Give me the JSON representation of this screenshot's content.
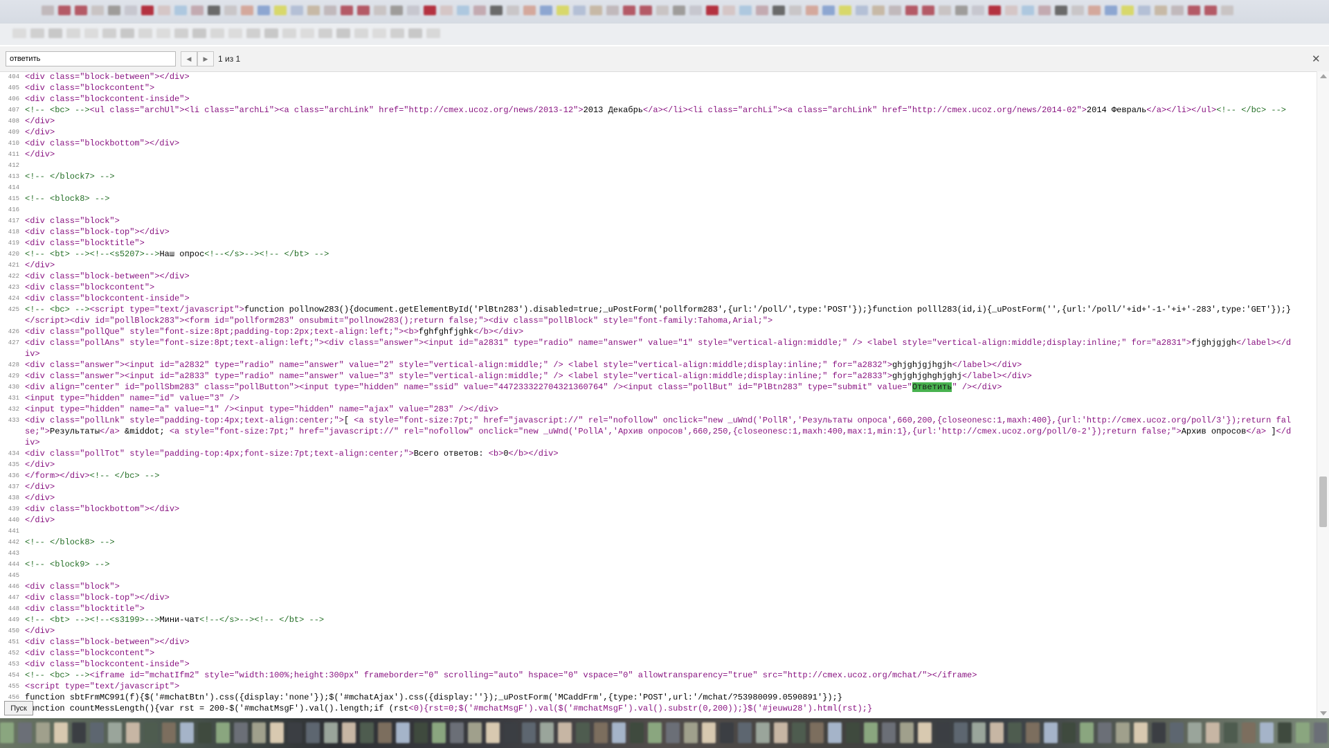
{
  "find_bar": {
    "query": "ответить",
    "prev_icon": "triangle-left-icon",
    "next_icon": "triangle-right-icon",
    "match_count": "1 из 1",
    "close_icon": "close-icon",
    "close_symbol": "✕"
  },
  "taskbar": {
    "start_label": "Пуск"
  },
  "scrollbar": {
    "position_fraction": 0.58
  },
  "source_lines": [
    {
      "n": "404",
      "html": "&lt;div class=\"block-between\"&gt;&lt;/div&gt;"
    },
    {
      "n": "405",
      "html": "&lt;div class=\"blockcontent\"&gt;"
    },
    {
      "n": "406",
      "html": "&lt;div class=\"blockcontent-inside\"&gt;"
    },
    {
      "n": "407",
      "html": "&lt;!-- &lt;bc&gt; --&gt;&lt;ul class=\"archUl\"&gt;&lt;li class=\"archLi\"&gt;&lt;a class=\"archLink\" href=\"http://cmex.ucoz.org/news/2013-12\"&gt;2013 Декабрь&lt;/a&gt;&lt;/li&gt;&lt;li class=\"archLi\"&gt;&lt;a class=\"archLink\" href=\"http://cmex.ucoz.org/news/2014-02\"&gt;2014 Февраль&lt;/a&gt;&lt;/li&gt;&lt;/ul&gt;&lt;!-- &lt;/bc&gt; --&gt;"
    },
    {
      "n": "408",
      "html": "&lt;/div&gt;"
    },
    {
      "n": "409",
      "html": "&lt;/div&gt;"
    },
    {
      "n": "410",
      "html": "&lt;div class=\"blockbottom\"&gt;&lt;/div&gt;"
    },
    {
      "n": "411",
      "html": "&lt;/div&gt;"
    },
    {
      "n": "412",
      "html": ""
    },
    {
      "n": "413",
      "html": "&lt;!-- &lt;/block7&gt; --&gt;"
    },
    {
      "n": "414",
      "html": ""
    },
    {
      "n": "415",
      "html": "&lt;!-- &lt;block8&gt; --&gt;"
    },
    {
      "n": "416",
      "html": ""
    },
    {
      "n": "417",
      "html": "&lt;div class=\"block\"&gt;"
    },
    {
      "n": "418",
      "html": "&lt;div class=\"block-top\"&gt;&lt;/div&gt;"
    },
    {
      "n": "419",
      "html": "&lt;div class=\"blocktitle\"&gt;"
    },
    {
      "n": "420",
      "html": "&lt;!-- &lt;bt&gt; --&gt;&lt;!--&lt;s5207&gt;--&gt;Наш опрос&lt;!--&lt;/s&gt;--&gt;&lt;!-- &lt;/bt&gt; --&gt;"
    },
    {
      "n": "421",
      "html": "&lt;/div&gt;"
    },
    {
      "n": "422",
      "html": "&lt;div class=\"block-between\"&gt;&lt;/div&gt;"
    },
    {
      "n": "423",
      "html": "&lt;div class=\"blockcontent\"&gt;"
    },
    {
      "n": "424",
      "html": "&lt;div class=\"blockcontent-inside\"&gt;"
    },
    {
      "n": "425",
      "html": "&lt;!-- &lt;bc&gt; --&gt;&lt;script type=\"text/javascript\"&gt;function pollnow283(){document.getElementById('PlBtn283').disabled=true;_uPostForm('pollform283',{url:'/poll/',type:'POST'});}function polll283(id,i){_uPostForm('',{url:'/poll/'+id+'-1-'+i+'-283',type:'GET'});}&lt;/script&gt;&lt;div id=\"pollBlock283\"&gt;&lt;form id=\"pollform283\" onsubmit=\"pollnow283();return false;\"&gt;&lt;div class=\"pollBlock\" style=\"font-family:Tahoma,Arial;\"&gt;"
    },
    {
      "n": "426",
      "html": "&lt;div class=\"pollQue\" style=\"font-size:8pt;padding-top:2px;text-align:left;\"&gt;&lt;b&gt;fghfghfjghk&lt;/b&gt;&lt;/div&gt;"
    },
    {
      "n": "427",
      "html": "&lt;div class=\"pollAns\" style=\"font-size:8pt;text-align:left;\"&gt;&lt;div class=\"answer\"&gt;&lt;input id=\"a2831\" type=\"radio\" name=\"answer\" value=\"1\" style=\"vertical-align:middle;\" /&gt; &lt;label style=\"vertical-align:middle;display:inline;\" for=\"a2831\"&gt;fjghjgjgh&lt;/label&gt;&lt;/div&gt;"
    },
    {
      "n": "428",
      "html": "&lt;div class=\"answer\"&gt;&lt;input id=\"a2832\" type=\"radio\" name=\"answer\" value=\"2\" style=\"vertical-align:middle;\" /&gt; &lt;label style=\"vertical-align:middle;display:inline;\" for=\"a2832\"&gt;ghjghjgjhgjh&lt;/label&gt;&lt;/div&gt;"
    },
    {
      "n": "429",
      "html": "&lt;div class=\"answer\"&gt;&lt;input id=\"a2833\" type=\"radio\" name=\"answer\" value=\"3\" style=\"vertical-align:middle;\" /&gt; &lt;label style=\"vertical-align:middle;display:inline;\" for=\"a2833\"&gt;ghjghjghghjghj&lt;/label&gt;&lt;/div&gt;"
    },
    {
      "n": "430",
      "html": "&lt;div align=\"center\" id=\"pollSbm283\" class=\"pollButton\"&gt;&lt;input type=\"hidden\" name=\"ssid\" value=\"447233322704321360764\" /&gt;&lt;input class=\"pollBut\" id=\"PlBtn283\" type=\"submit\" value=\"Ответить\" /&gt;&lt;/div&gt;"
    },
    {
      "n": "431",
      "html": "&lt;input type=\"hidden\" name=\"id\" value=\"3\" /&gt;"
    },
    {
      "n": "432",
      "html": "&lt;input type=\"hidden\" name=\"a\" value=\"1\" /&gt;&lt;input type=\"hidden\" name=\"ajax\" value=\"283\" /&gt;&lt;/div&gt;"
    },
    {
      "n": "433",
      "html": "&lt;div class=\"pollLnk\" style=\"padding-top:4px;text-align:center;\"&gt;[ &lt;a style=\"font-size:7pt;\" href=\"javascript://\" rel=\"nofollow\" onclick=\"new _uWnd('PollR','Результаты опроса',660,200,{closeonesc:1,maxh:400},{url:'http://cmex.ucoz.org/poll/3'});return false;\"&gt;Результаты&lt;/a&gt; &amp;middot; &lt;a style=\"font-size:7pt;\" href=\"javascript://\" rel=\"nofollow\" onclick=\"new _uWnd('PollA','Архив опросов',660,250,{closeonesc:1,maxh:400,max:1,min:1},{url:'http://cmex.ucoz.org/poll/0-2'});return false;\"&gt;Архив опросов&lt;/a&gt; ]&lt;/div&gt;"
    },
    {
      "n": "434",
      "html": "&lt;div class=\"pollTot\" style=\"padding-top:4px;font-size:7pt;text-align:center;\"&gt;Всего ответов: &lt;b&gt;0&lt;/b&gt;&lt;/div&gt;"
    },
    {
      "n": "435",
      "html": "&lt;/div&gt;"
    },
    {
      "n": "436",
      "html": "&lt;/form&gt;&lt;/div&gt;&lt;!-- &lt;/bc&gt; --&gt;"
    },
    {
      "n": "437",
      "html": "&lt;/div&gt;"
    },
    {
      "n": "438",
      "html": "&lt;/div&gt;"
    },
    {
      "n": "439",
      "html": "&lt;div class=\"blockbottom\"&gt;&lt;/div&gt;"
    },
    {
      "n": "440",
      "html": "&lt;/div&gt;"
    },
    {
      "n": "441",
      "html": ""
    },
    {
      "n": "442",
      "html": "&lt;!-- &lt;/block8&gt; --&gt;"
    },
    {
      "n": "443",
      "html": ""
    },
    {
      "n": "444",
      "html": "&lt;!-- &lt;block9&gt; --&gt;"
    },
    {
      "n": "445",
      "html": ""
    },
    {
      "n": "446",
      "html": "&lt;div class=\"block\"&gt;"
    },
    {
      "n": "447",
      "html": "&lt;div class=\"block-top\"&gt;&lt;/div&gt;"
    },
    {
      "n": "448",
      "html": "&lt;div class=\"blocktitle\"&gt;"
    },
    {
      "n": "449",
      "html": "&lt;!-- &lt;bt&gt; --&gt;&lt;!--&lt;s3199&gt;--&gt;Мини-чат&lt;!--&lt;/s&gt;--&gt;&lt;!-- &lt;/bt&gt; --&gt;"
    },
    {
      "n": "450",
      "html": "&lt;/div&gt;"
    },
    {
      "n": "451",
      "html": "&lt;div class=\"block-between\"&gt;&lt;/div&gt;"
    },
    {
      "n": "452",
      "html": "&lt;div class=\"blockcontent\"&gt;"
    },
    {
      "n": "453",
      "html": "&lt;div class=\"blockcontent-inside\"&gt;"
    },
    {
      "n": "454",
      "html": "&lt;!-- &lt;bc&gt; --&gt;&lt;iframe id=\"mchatIfm2\" style=\"width:100%;height:300px\" frameborder=\"0\" scrolling=\"auto\" hspace=\"0\" vspace=\"0\" allowtransparency=\"true\" src=\"http://cmex.ucoz.org/mchat/\"&gt;&lt;/iframe&gt;"
    },
    {
      "n": "455",
      "html": "&lt;script type=\"text/javascript\"&gt;"
    },
    {
      "n": "456",
      "html": "function sbtFrmMC991(f){$('#mchatBtn').css({display:'none'});$('#mchatAjax').css({display:''});_uPostForm('MCaddFrm',{type:'POST',url:'/mchat/?53980099.0590891'});}"
    },
    {
      "n": "457",
      "html": "function countMessLength(){var rst = 200-$('#mchatMsgF').val().length;if (rst&lt;0){rst=0;$('#mchatMsgF').val($('#mchatMsgF').val().substr(0,200));}$('#jeuwu28').html(rst);}"
    }
  ]
}
